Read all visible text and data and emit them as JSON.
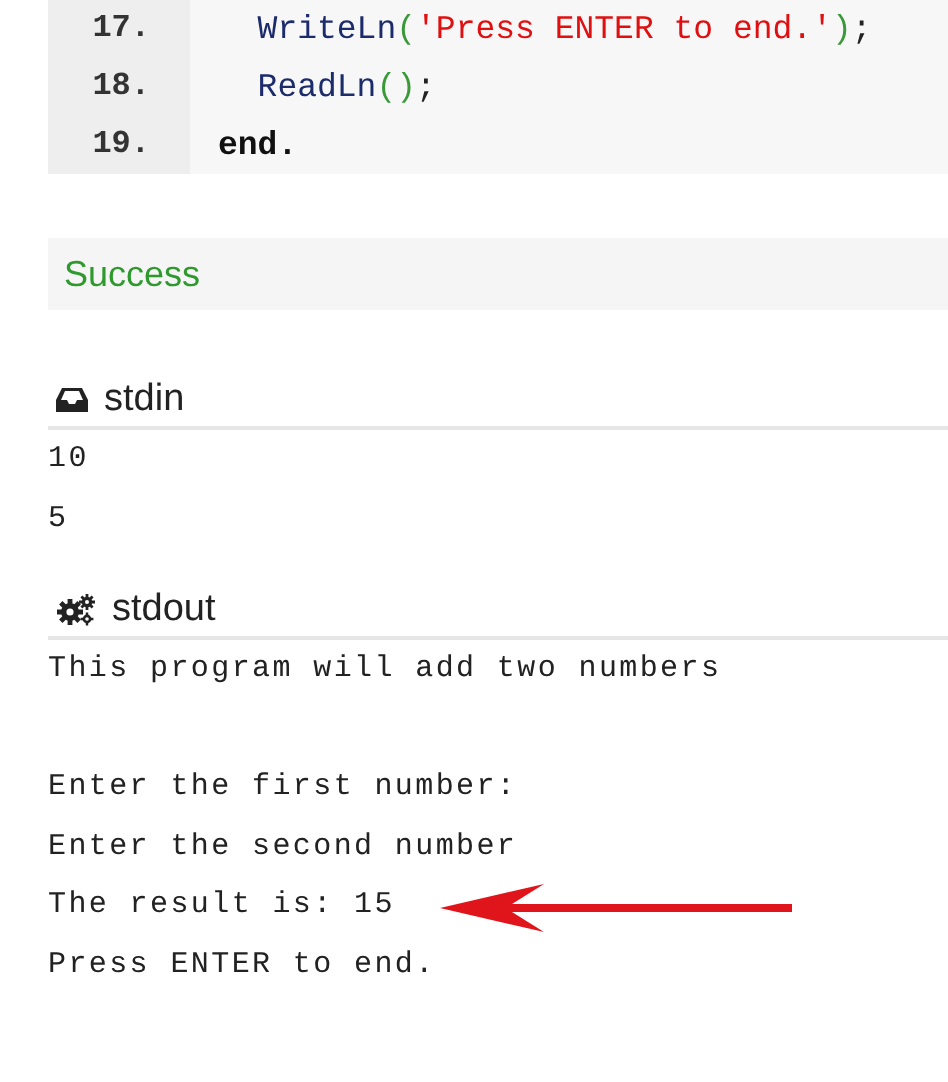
{
  "code": {
    "lines": [
      {
        "number": "17.",
        "tokens": [
          {
            "kind": "ident",
            "text": "  WriteLn"
          },
          {
            "kind": "paren",
            "text": "("
          },
          {
            "kind": "string",
            "text": "'Press ENTER to end.'"
          },
          {
            "kind": "paren",
            "text": ")"
          },
          {
            "kind": "punct",
            "text": ";"
          }
        ]
      },
      {
        "number": "18.",
        "tokens": [
          {
            "kind": "ident",
            "text": "  ReadLn"
          },
          {
            "kind": "paren",
            "text": "()"
          },
          {
            "kind": "punct",
            "text": ";"
          }
        ]
      },
      {
        "number": "19.",
        "tokens": [
          {
            "kind": "keyword",
            "text": "end."
          }
        ]
      }
    ]
  },
  "status": {
    "text": "Success"
  },
  "stdin": {
    "title": "stdin",
    "lines": [
      "10",
      "5"
    ]
  },
  "stdout": {
    "title": "stdout",
    "lines": [
      {
        "text": "This program will add two numbers",
        "space_before": false,
        "arrow": false
      },
      {
        "text": "Enter the first number:",
        "space_before": true,
        "arrow": false
      },
      {
        "text": "Enter the second number",
        "space_before": false,
        "arrow": false
      },
      {
        "text": "The result is: 15",
        "space_before": false,
        "arrow": true
      },
      {
        "text": "Press ENTER to end.",
        "space_before": false,
        "arrow": false
      }
    ]
  }
}
